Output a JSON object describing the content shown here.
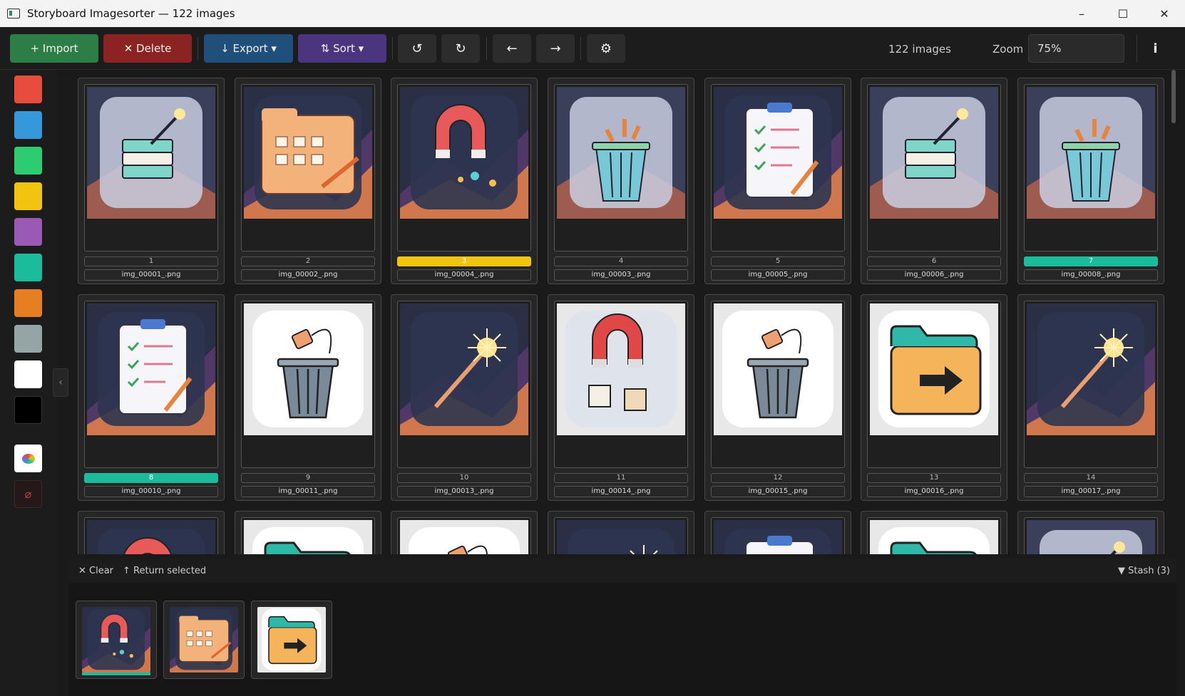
{
  "window": {
    "title": "Storyboard Imagesorter — 122 images",
    "minimize": "–",
    "maximize": "☐",
    "close": "✕"
  },
  "toolbar": {
    "import_label": "+ Import",
    "delete_label": "✕ Delete",
    "export_label": "↓ Export ▾",
    "sort_label": "⇅ Sort ▾",
    "rotate_left": "↺",
    "rotate_right": "↻",
    "prev": "←",
    "next": "→",
    "settings": "⚙",
    "count": "122 images",
    "zoom_label": "Zoom",
    "zoom_value": "75%",
    "info": "i"
  },
  "palette": {
    "colors": [
      "#e74c3c",
      "#3498db",
      "#2ecc71",
      "#f1c40f",
      "#9b59b6",
      "#1abc9c",
      "#e67e22",
      "#95a5a6",
      "#ffffff",
      "#000000"
    ],
    "custom_icon": "palette-icon",
    "none_icon": "no-color-icon",
    "collapse": "‹"
  },
  "grid": {
    "cards": [
      {
        "num": "1",
        "file": "img_00001_.png",
        "icon": "server-wand",
        "tag": ""
      },
      {
        "num": "2",
        "file": "img_00002_.png",
        "icon": "folder-pencil",
        "tag": ""
      },
      {
        "num": "3",
        "file": "img_00004_.png",
        "icon": "magnet",
        "tag": "#f1c40f"
      },
      {
        "num": "4",
        "file": "img_00003_.png",
        "icon": "trash-plugs",
        "tag": ""
      },
      {
        "num": "5",
        "file": "img_00005_.png",
        "icon": "clipboard",
        "tag": ""
      },
      {
        "num": "6",
        "file": "img_00006_.png",
        "icon": "server-wand",
        "tag": ""
      },
      {
        "num": "7",
        "file": "img_00008_.png",
        "icon": "trash-plugs",
        "tag": "#1abc9c"
      },
      {
        "num": "8",
        "file": "img_00010_.png",
        "icon": "clipboard",
        "tag": "#1abc9c"
      },
      {
        "num": "9",
        "file": "img_00011_.png",
        "icon": "trash-plug",
        "tag": ""
      },
      {
        "num": "10",
        "file": "img_00013_.png",
        "icon": "wand",
        "tag": ""
      },
      {
        "num": "11",
        "file": "img_00014_.png",
        "icon": "magnet-blocks",
        "tag": ""
      },
      {
        "num": "12",
        "file": "img_00015_.png",
        "icon": "trash-plug",
        "tag": ""
      },
      {
        "num": "13",
        "file": "img_00016_.png",
        "icon": "folder-arrow",
        "tag": ""
      },
      {
        "num": "14",
        "file": "img_00017_.png",
        "icon": "wand",
        "tag": ""
      }
    ]
  },
  "stash": {
    "clear_label": "✕ Clear",
    "return_label": "↑ Return selected",
    "toggle_label": "▼  Stash  (3)",
    "items": [
      {
        "icon": "magnet",
        "tag": "#1abc9c"
      },
      {
        "icon": "folder-pencil",
        "tag": ""
      },
      {
        "icon": "folder-arrow",
        "tag": ""
      }
    ]
  }
}
